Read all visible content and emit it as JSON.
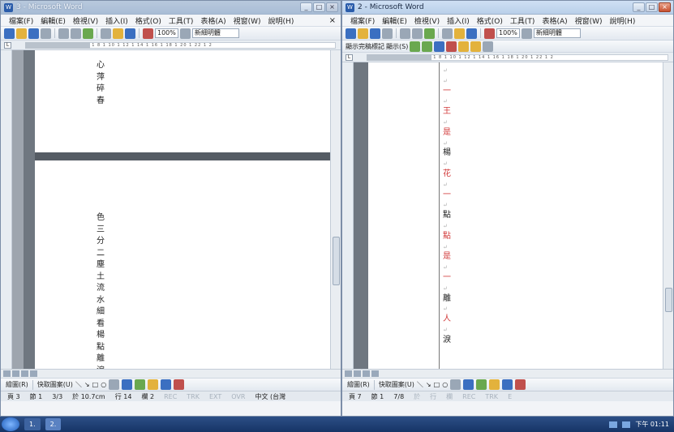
{
  "left_window": {
    "title": "3 - Microsoft Word",
    "menu": [
      "檔案(F)",
      "編輯(E)",
      "檢視(V)",
      "插入(I)",
      "格式(O)",
      "工具(T)",
      "表格(A)",
      "視窗(W)",
      "說明(H)"
    ],
    "doc_close": "×",
    "zoom": "100%",
    "font": "新細明體",
    "ruler": "1 6 1 4 1 2 1  2 1 4 1 6 1 8 1 10 1 12 1 14 1 16 1 18 1 20 1 22 1 2",
    "page1_text": [
      "心",
      "萍",
      "碎",
      "春"
    ],
    "page2_text": [
      "色",
      "三",
      "分",
      "二",
      "塵",
      "土",
      "流",
      "水",
      "細",
      "看",
      "楊",
      "點",
      "離",
      "淚"
    ],
    "status": {
      "page": "頁 3",
      "section": "節 1",
      "pages": "3/3",
      "position": "於 10.7cm",
      "line": "行 14",
      "column": "欄 2",
      "rec": "REC",
      "trk": "TRK",
      "ext": "EXT",
      "ovr": "OVR",
      "language": "中文 (台灣"
    },
    "drawbar": {
      "draw": "繪圖(R)",
      "autoshapes": "快取圖案(U)"
    }
  },
  "right_window": {
    "title": "2 - Microsoft Word",
    "menu": [
      "檔案(F)",
      "編輯(E)",
      "檢視(V)",
      "插入(I)",
      "格式(O)",
      "工具(T)",
      "表格(A)",
      "視窗(W)",
      "說明(H)"
    ],
    "zoom": "100%",
    "font": "新細明體",
    "review_bar": [
      "顯示完稿標記",
      "顯示(S)"
    ],
    "ruler": "1 6 1 4 1 2 1  2 1 4 1 6 1 8 1 10 1 12 1 14 1 16 1 18 1 20 1 22 1 2",
    "text": [
      {
        "ch": "",
        "red": false
      },
      {
        "ch": "",
        "red": false
      },
      {
        "ch": "一",
        "red": true
      },
      {
        "ch": "",
        "red": false
      },
      {
        "ch": "王",
        "red": true
      },
      {
        "ch": "",
        "red": false
      },
      {
        "ch": "是",
        "red": true
      },
      {
        "ch": "",
        "red": false
      },
      {
        "ch": "楊",
        "red": false
      },
      {
        "ch": "",
        "red": false
      },
      {
        "ch": "花",
        "red": true
      },
      {
        "ch": "",
        "red": false
      },
      {
        "ch": "一",
        "red": true
      },
      {
        "ch": "",
        "red": false
      },
      {
        "ch": "點",
        "red": false
      },
      {
        "ch": "",
        "red": false
      },
      {
        "ch": "點",
        "red": true
      },
      {
        "ch": "",
        "red": false
      },
      {
        "ch": "是",
        "red": true
      },
      {
        "ch": "",
        "red": false
      },
      {
        "ch": "一",
        "red": true
      },
      {
        "ch": "",
        "red": false
      },
      {
        "ch": "離",
        "red": false
      },
      {
        "ch": "",
        "red": false
      },
      {
        "ch": "人",
        "red": true
      },
      {
        "ch": "",
        "red": false
      },
      {
        "ch": "淚",
        "red": false
      }
    ],
    "status": {
      "page": "頁 7",
      "section": "節 1",
      "pages": "7/8",
      "position": "於",
      "line": "行",
      "column": "欄",
      "rec": "REC",
      "trk": "TRK",
      "ext": "E"
    },
    "drawbar": {
      "draw": "繪圖(R)",
      "autoshapes": "快取圖案(U)"
    }
  },
  "taskbar": {
    "task1": "1.",
    "task2": "2.",
    "clock": "下午 01:11"
  }
}
